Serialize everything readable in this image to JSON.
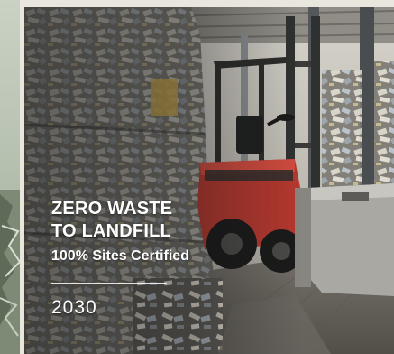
{
  "card": {
    "headline_line1": "ZERO WASTE",
    "headline_line2": "TO LANDFILL",
    "subline": "100% Sites Certified",
    "year": "2030"
  },
  "colors": {
    "text": "#ffffff",
    "forklift_body": "#b5382e",
    "forklift_frame": "#3a3b38"
  },
  "photo": {
    "subject": "forklift-beside-baled-waste"
  }
}
